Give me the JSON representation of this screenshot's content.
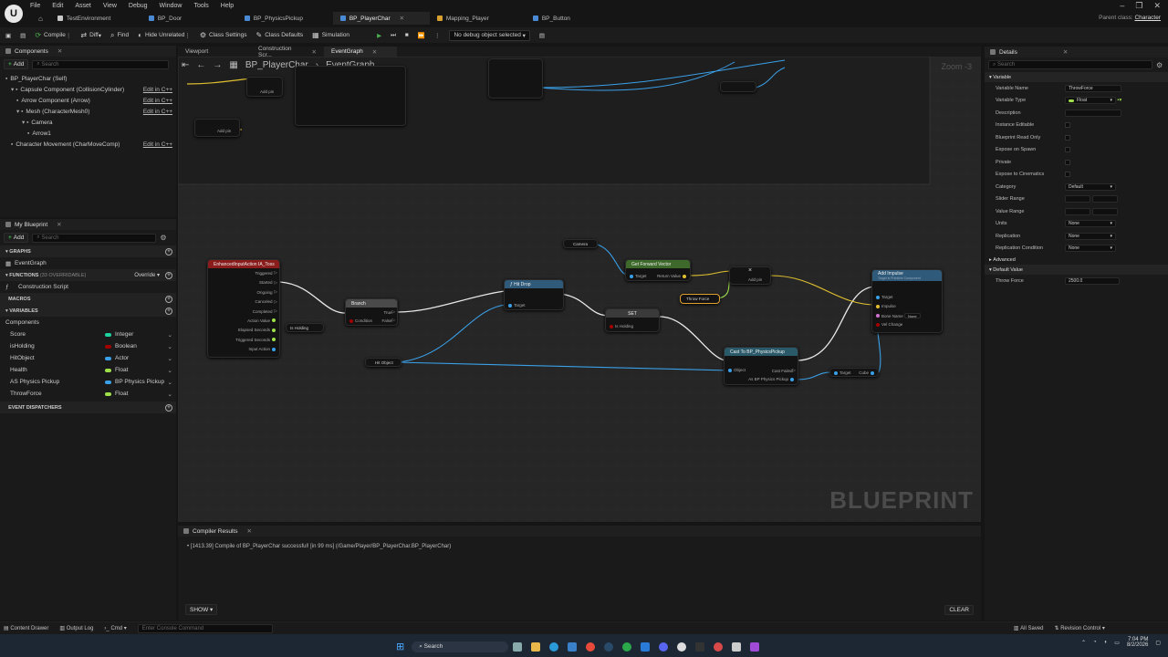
{
  "menu": [
    "File",
    "Edit",
    "Asset",
    "View",
    "Debug",
    "Window",
    "Tools",
    "Help"
  ],
  "tabs": [
    {
      "label": "TestEnvironment",
      "color": "#c8c8c8"
    },
    {
      "label": "BP_Door",
      "color": "#4a8ad4"
    },
    {
      "label": "BP_PhysicsPickup",
      "color": "#4a8ad4"
    },
    {
      "label": "BP_PlayerChar",
      "color": "#4a8ad4"
    },
    {
      "label": "Mapping_Player",
      "color": "#d8a030"
    },
    {
      "label": "BP_Button",
      "color": "#4a8ad4"
    }
  ],
  "parent_label": "Parent class:",
  "parent_value": "Character",
  "toolbar": {
    "compile": "Compile",
    "diff": "Diff",
    "find": "Find",
    "hide_unrelated": "Hide Unrelated",
    "class_settings": "Class Settings",
    "class_defaults": "Class Defaults",
    "simulation": "Simulation",
    "debug_object": "No debug object selected"
  },
  "components": {
    "title": "Components",
    "add": "Add",
    "search_placeholder": "Search",
    "items": [
      {
        "label": "BP_PlayerChar (Self)",
        "indent": 0,
        "edit": ""
      },
      {
        "label": "Capsule Component (CollisionCylinder)",
        "indent": 1,
        "edit": "Edit in C++"
      },
      {
        "label": "Arrow Component (Arrow)",
        "indent": 2,
        "edit": "Edit in C++"
      },
      {
        "label": "Mesh (CharacterMesh0)",
        "indent": 2,
        "edit": "Edit in C++"
      },
      {
        "label": "Camera",
        "indent": 3,
        "edit": ""
      },
      {
        "label": "Arrow1",
        "indent": 4,
        "edit": ""
      },
      {
        "label": "Character Movement (CharMoveComp)",
        "indent": 1,
        "edit": "Edit in C++"
      }
    ]
  },
  "my_blueprint": {
    "title": "My Blueprint",
    "add": "Add",
    "search_placeholder": "Search",
    "graphs": "GRAPHS",
    "event_graph": "EventGraph",
    "functions": "FUNCTIONS",
    "functions_count": "(33 OVERRIDABLE)",
    "override": "Override",
    "construction_script": "Construction Script",
    "macros": "MACROS",
    "variables": "VARIABLES",
    "components_cat": "Components",
    "vars": [
      {
        "name": "Score",
        "type": "Integer",
        "color": "#1ed3a0"
      },
      {
        "name": "isHolding",
        "type": "Boolean",
        "color": "#a30000"
      },
      {
        "name": "HitObject",
        "type": "Actor",
        "color": "#3aa0e8"
      },
      {
        "name": "Health",
        "type": "Float",
        "color": "#9ee04a"
      },
      {
        "name": "AS Physics Pickup",
        "type": "BP Physics Pickup",
        "color": "#3aa0e8"
      },
      {
        "name": "ThrowForce",
        "type": "Float",
        "color": "#9ee04a"
      }
    ],
    "event_dispatchers": "EVENT DISPATCHERS"
  },
  "graph_tabs": {
    "viewport": "Viewport",
    "construction": "Construction Scr...",
    "event": "EventGraph"
  },
  "breadcrumb": {
    "bp": "BP_PlayerChar",
    "graph": "EventGraph"
  },
  "zoom": "Zoom -3",
  "watermark": "BLUEPRINT",
  "nodes": {
    "enhanced": {
      "title": "EnhancedInputAction IA_Toss",
      "pins": [
        "Triggered",
        "Started",
        "Ongoing",
        "Canceled",
        "Completed",
        "Action Value",
        "Elapsed Seconds",
        "Triggered Seconds",
        "Input Action"
      ]
    },
    "branch": {
      "title": "Branch",
      "cond": "Condition",
      "t": "True",
      "f": "False"
    },
    "is_holding": "Is Holding",
    "hit_object": "Hit Object",
    "set": {
      "title": "SET",
      "pin": "Is Holding"
    },
    "camera": "Camera",
    "forward": {
      "title": "Get Forward Vector",
      "target": "Target",
      "ret": "Return Value"
    },
    "throw_force": "Throw Force",
    "multiply": "Add pin",
    "impulse": {
      "title": "Add Impulse",
      "sub": "Target is Primitive Component",
      "target": "Target",
      "impulse": "Impulse",
      "bone": "Bone Name",
      "none": "None",
      "vel": "Vel Change"
    },
    "cast": {
      "title": "Cast To BP_PhysicsPickup",
      "object": "Object",
      "failed": "Cast Failed",
      "as": "As BP Physics Pickup"
    },
    "cube": {
      "target": "Target",
      "cube": "Cube"
    }
  },
  "details": {
    "title": "Details",
    "search_placeholder": "Search",
    "variable_section": "Variable",
    "rows": [
      {
        "label": "Variable Name",
        "value": "ThrowForce",
        "kind": "text"
      },
      {
        "label": "Variable Type",
        "value": "Float",
        "kind": "type"
      },
      {
        "label": "Description",
        "value": "",
        "kind": "text"
      },
      {
        "label": "Instance Editable",
        "value": "",
        "kind": "check"
      },
      {
        "label": "Blueprint Read Only",
        "value": "",
        "kind": "check"
      },
      {
        "label": "Expose on Spawn",
        "value": "",
        "kind": "check"
      },
      {
        "label": "Private",
        "value": "",
        "kind": "check"
      },
      {
        "label": "Expose to Cinematics",
        "value": "",
        "kind": "check"
      },
      {
        "label": "Category",
        "value": "Default",
        "kind": "drop"
      },
      {
        "label": "Slider Range",
        "value": "",
        "kind": "range"
      },
      {
        "label": "Value Range",
        "value": "",
        "kind": "range"
      },
      {
        "label": "Units",
        "value": "None",
        "kind": "drop"
      },
      {
        "label": "Replication",
        "value": "None",
        "kind": "drop"
      },
      {
        "label": "Replication Condition",
        "value": "None",
        "kind": "drop"
      }
    ],
    "advanced": "Advanced",
    "default_value": "Default Value",
    "throw_force_label": "Throw Force",
    "throw_force_value": "2500.0"
  },
  "compiler": {
    "title": "Compiler Results",
    "message": "[1413.39] Compile of BP_PlayerChar successful! [in 99 ms] (/Game/Player/BP_PlayerChar.BP_PlayerChar)",
    "show": "SHOW",
    "clear": "CLEAR"
  },
  "status": {
    "content_drawer": "Content Drawer",
    "output_log": "Output Log",
    "cmd": "Cmd",
    "console_placeholder": "Enter Console Command",
    "all_saved": "All Saved",
    "revision": "Revision Control"
  },
  "taskbar": {
    "search": "Search",
    "time": "7:04 PM",
    "date": "8/2/2026"
  }
}
